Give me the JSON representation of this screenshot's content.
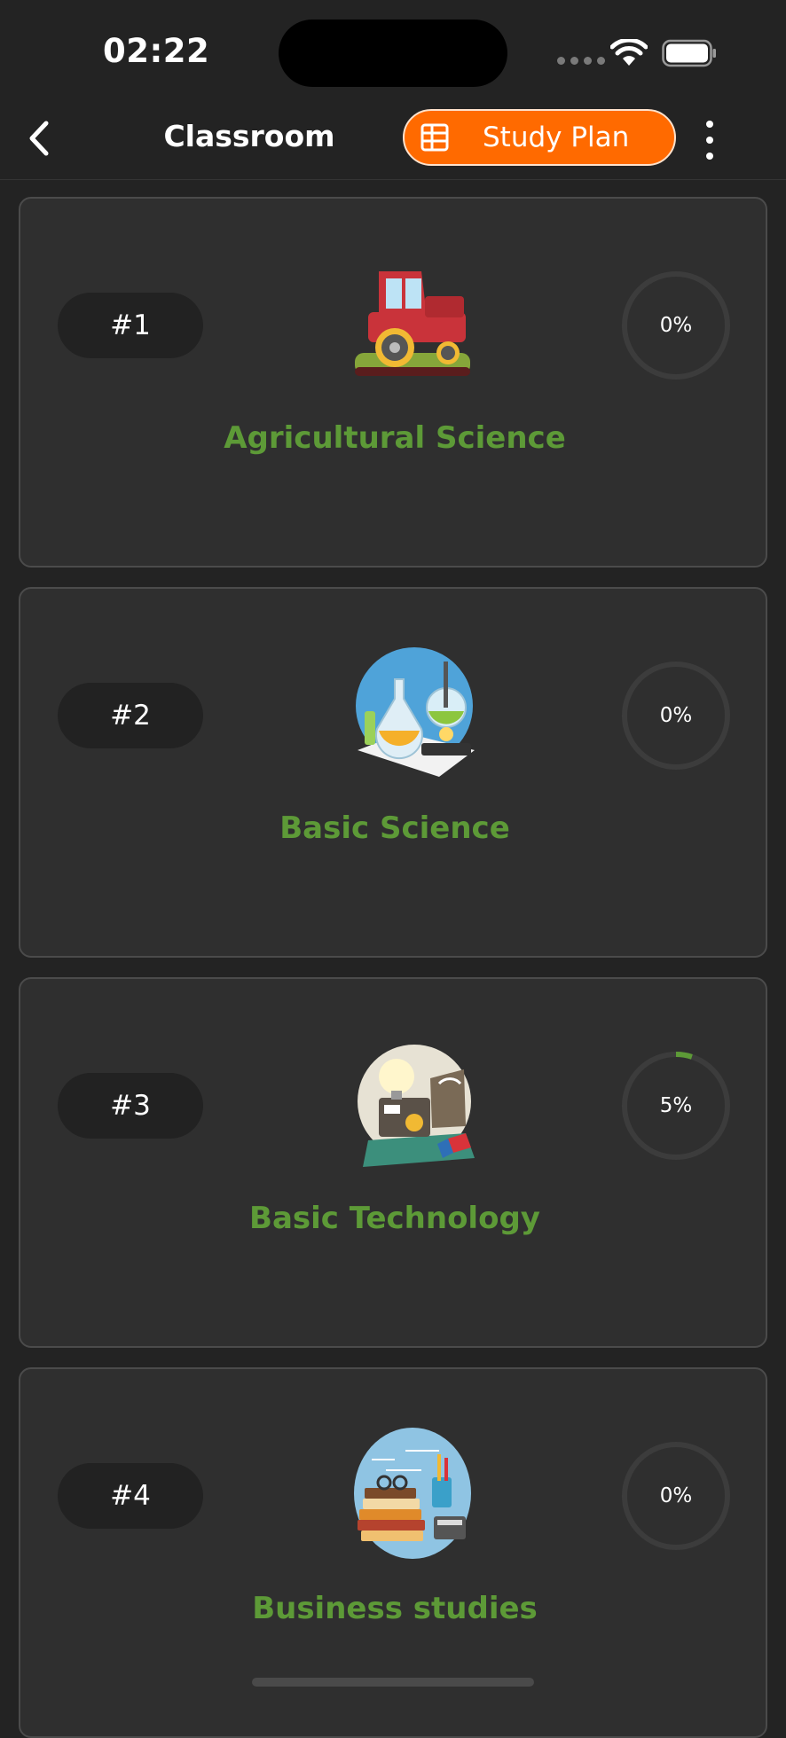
{
  "status_bar": {
    "time": "02:22"
  },
  "header": {
    "title": "Classroom",
    "study_plan_label": "Study Plan",
    "back_icon": "chevron-left-icon",
    "more_icon": "more-vertical-icon",
    "study_plan_icon": "grid-table-icon"
  },
  "colors": {
    "background": "#232323",
    "card": "#2f2f2f",
    "accent_orange": "#ff6a00",
    "title_green": "#5d9a37",
    "progress_green": "#5d9a37",
    "progress_track": "#3c3c3c"
  },
  "courses": [
    {
      "number": "#1",
      "title": "Agricultural Science",
      "progress_text": "0%",
      "progress": 0,
      "image": "tractor-illustration"
    },
    {
      "number": "#2",
      "title": "Basic Science",
      "progress_text": "0%",
      "progress": 0,
      "image": "science-lab-illustration"
    },
    {
      "number": "#3",
      "title": "Basic Technology",
      "progress_text": "5%",
      "progress": 5,
      "image": "technology-lab-illustration"
    },
    {
      "number": "#4",
      "title": "Business studies",
      "progress_text": "0%",
      "progress": 0,
      "image": "business-books-illustration"
    }
  ]
}
